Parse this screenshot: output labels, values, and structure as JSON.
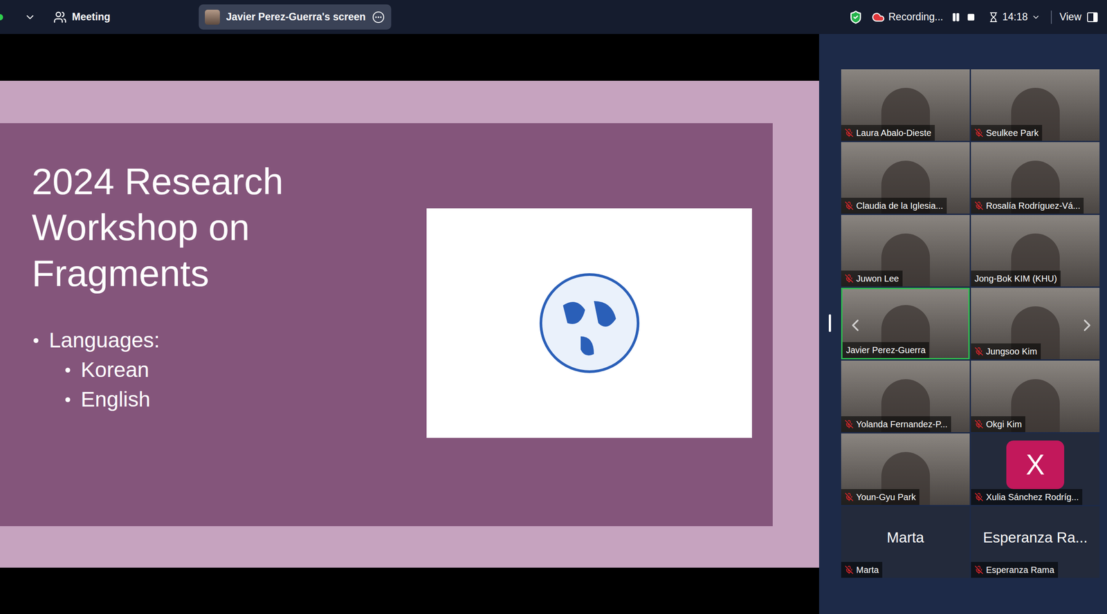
{
  "top_bar": {
    "meeting_label": "Meeting",
    "share_pill": "Javier Perez-Guerra's screen",
    "secure": true,
    "recording": {
      "label": "Recording...",
      "active": true,
      "paused": false
    },
    "timer": "14:18",
    "view_label": "View"
  },
  "slide": {
    "title": "2024 Research Workshop on Fragments",
    "bullets": [
      {
        "text": "Languages:",
        "indent": 0
      },
      {
        "text": "Korean",
        "indent": 1
      },
      {
        "text": "English",
        "indent": 1
      }
    ]
  },
  "gallery": {
    "has_prev": true,
    "has_next": true,
    "tiles": [
      {
        "name": "Laura Abalo-Dieste",
        "kind": "video",
        "muted": true,
        "speaking": false
      },
      {
        "name": "Seulkee Park",
        "kind": "video",
        "muted": true,
        "speaking": false
      },
      {
        "name": "Claudia de la Iglesia...",
        "kind": "video",
        "muted": true,
        "speaking": false
      },
      {
        "name": "Rosalía Rodríguez-Vá...",
        "kind": "video",
        "muted": true,
        "speaking": false
      },
      {
        "name": "Juwon Lee",
        "kind": "video",
        "muted": true,
        "speaking": false
      },
      {
        "name": "Jong-Bok KIM (KHU)",
        "kind": "video",
        "muted": false,
        "speaking": false
      },
      {
        "name": "Javier Perez-Guerra",
        "kind": "video",
        "muted": false,
        "speaking": true
      },
      {
        "name": "Jungsoo Kim",
        "kind": "video",
        "muted": true,
        "speaking": false
      },
      {
        "name": "Yolanda Fernandez-P...",
        "kind": "video",
        "muted": true,
        "speaking": false
      },
      {
        "name": "Okgi Kim",
        "kind": "video",
        "muted": true,
        "speaking": false
      },
      {
        "name": "Youn-Gyu Park",
        "kind": "video",
        "muted": true,
        "speaking": false
      },
      {
        "name": "Xulia Sánchez Rodríg...",
        "kind": "avatar",
        "muted": true,
        "speaking": false,
        "avatar_letter": "X",
        "color": "#c2185b"
      },
      {
        "name": "Marta",
        "kind": "name",
        "muted": true,
        "speaking": false,
        "display_name": "Marta"
      },
      {
        "name": "Esperanza Rama",
        "kind": "name",
        "muted": true,
        "speaking": false,
        "display_name": "Esperanza Ra..."
      }
    ]
  }
}
